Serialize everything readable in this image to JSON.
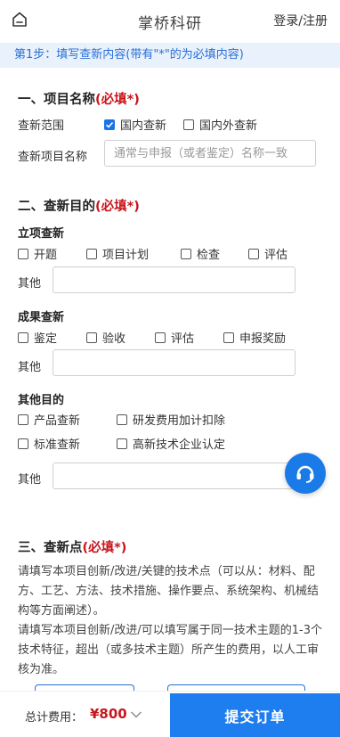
{
  "header": {
    "title": "掌桥科研",
    "login_label": "登录/注册",
    "home_icon": "home-icon"
  },
  "step_banner": "第1步：填写查新内容(带有\"*\"的为必填内容)",
  "section1": {
    "title": "一、项目名称",
    "required": "(必填*)",
    "scope_label": "查新范围",
    "scope_options": [
      {
        "label": "国内查新",
        "checked": true
      },
      {
        "label": "国内外查新",
        "checked": false
      }
    ],
    "project_name_label": "查新项目名称",
    "project_name_placeholder": "通常与申报（或者鉴定）名称一致"
  },
  "section2": {
    "title": "二、查新目的",
    "required": "(必填*)",
    "lixiang": {
      "title": "立项查新",
      "options": [
        "开题",
        "项目计划",
        "检查",
        "评估"
      ],
      "other_label": "其他"
    },
    "chengguo": {
      "title": "成果查新",
      "options": [
        "鉴定",
        "验收",
        "评估",
        "申报奖励"
      ],
      "other_label": "其他"
    },
    "qita": {
      "title": "其他目的",
      "options": [
        "产品查新",
        "研发费用加计扣除",
        "标准查新",
        "高新技术企业认定"
      ],
      "other_label": "其他"
    }
  },
  "section3": {
    "title": "三、查新点",
    "required": "(必填*)",
    "para1": "请填写本项目创新/改进/关键的技术点（可以从：材料、配方、工艺、方法、技术措施、操作要点、系统架构、机械结构等方面阐述）。",
    "para2": "请填写本项目创新/改进/可以填写属于同一技术主题的1-3个技术特征，超出（或多技术主题）所产生的费用，以人工审核为准。"
  },
  "footer": {
    "total_label": "总计费用：",
    "total_amount": "¥800",
    "submit_label": "提交订单"
  },
  "colors": {
    "accent": "#1e7ef0",
    "required": "#c8161d",
    "banner_bg": "#e8f1fc",
    "banner_text": "#2a6fd6"
  }
}
